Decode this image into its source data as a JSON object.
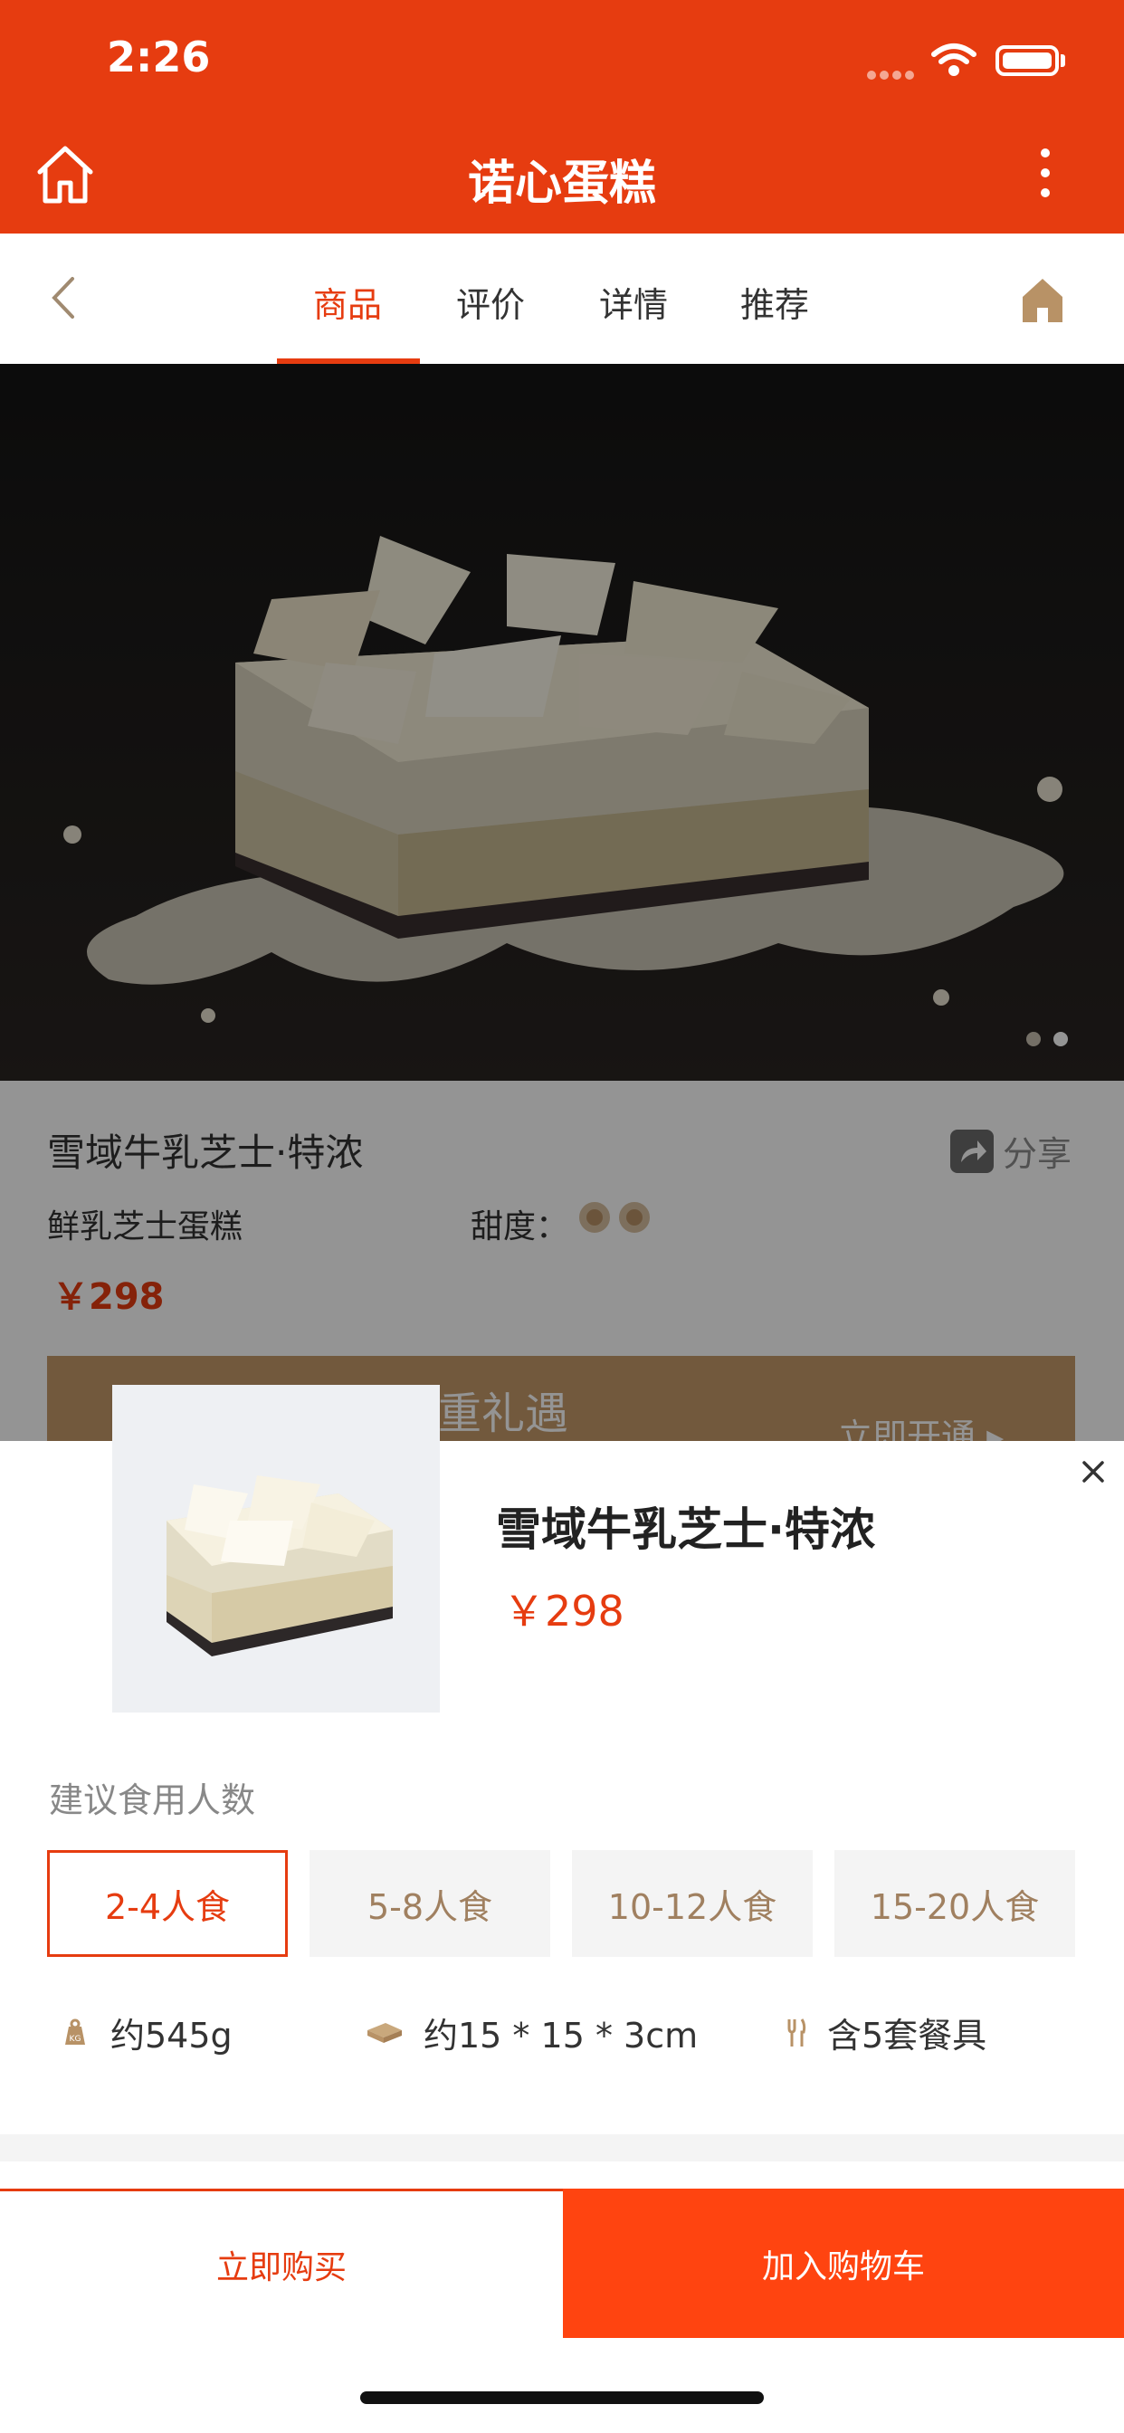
{
  "status_bar": {
    "time": "2:26"
  },
  "header": {
    "title": "诺心蛋糕"
  },
  "tabs": [
    {
      "label": "商品",
      "active": true
    },
    {
      "label": "评价",
      "active": false
    },
    {
      "label": "详情",
      "active": false
    },
    {
      "label": "推荐",
      "active": false
    }
  ],
  "product": {
    "name": "雪域牛乳芝士·特浓",
    "subtitle": "鲜乳芝士蛋糕",
    "sweetness_label": "甜度：",
    "sweetness_level": 2,
    "price": "￥298",
    "share_label": "分享",
    "vip_text": "重礼遇",
    "vip_action": "立即开通 ▸"
  },
  "carousel": {
    "total": 2,
    "current": 2
  },
  "sheet": {
    "product_name": "雪域牛乳芝士·特浓",
    "price": "￥298",
    "servings_label": "建议食用人数",
    "options": [
      {
        "label": "2-4人食",
        "selected": true
      },
      {
        "label": "5-8人食",
        "selected": false
      },
      {
        "label": "10-12人食",
        "selected": false
      },
      {
        "label": "15-20人食",
        "selected": false
      }
    ],
    "specs": {
      "weight": "约545g",
      "size": "约15 * 15 * 3cm",
      "tableware": "含5套餐具"
    }
  },
  "footer": {
    "buy_now": "立即购买",
    "add_to_cart": "加入购物车"
  },
  "colors": {
    "accent": "#e63c10",
    "cart_button": "#ff4410",
    "gold": "#b89266"
  }
}
